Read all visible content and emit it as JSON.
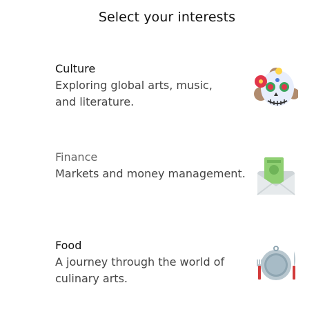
{
  "page": {
    "title": "Select your interests"
  },
  "interests": [
    {
      "title": "Culture",
      "description": "Exploring global arts, music, and literature.",
      "icon": "sugar-skull-icon",
      "selected": true
    },
    {
      "title": "Finance",
      "description": "Markets and money management.",
      "icon": "money-envelope-icon",
      "selected": false
    },
    {
      "title": "Food",
      "description": "A journey through the world of culinary arts.",
      "icon": "plate-fork-knife-icon",
      "selected": true
    }
  ],
  "colors": {
    "title_text": "#111111",
    "muted_title": "#666666",
    "description_text": "#444444"
  }
}
